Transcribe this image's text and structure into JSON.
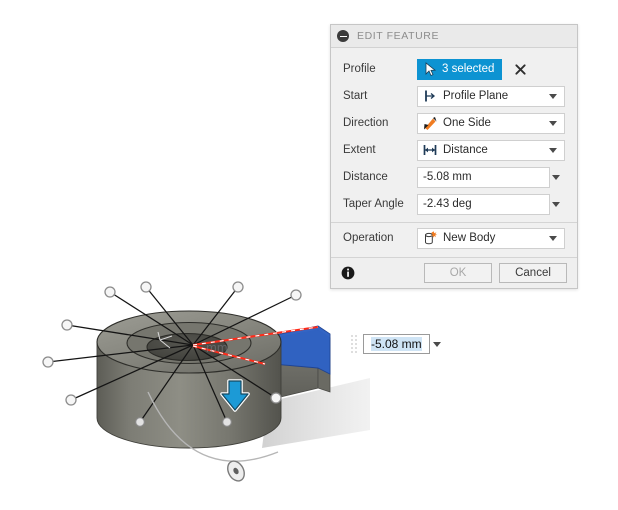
{
  "app": {
    "accent_blue": "#0d93d2",
    "manipulator_blue": "#1c9ad6",
    "highlight_red": "#ff2a18",
    "profile_blue": "#2f62c4",
    "body_grey": "#6f6f68"
  },
  "dialog": {
    "title": "EDIT FEATURE",
    "collapse_icon": "minus-circle-icon",
    "rows": [
      {
        "label": "Profile",
        "control": "selection",
        "value": "3 selected",
        "icon": "cursor-arrow-icon",
        "clear_icon": "close-x-icon"
      },
      {
        "label": "Start",
        "control": "combo",
        "value": "Profile Plane",
        "icon": "profile-plane-icon"
      },
      {
        "label": "Direction",
        "control": "combo",
        "value": "One Side",
        "icon": "one-side-arrow-icon"
      },
      {
        "label": "Extent",
        "control": "combo",
        "value": "Distance",
        "icon": "distance-extent-icon"
      },
      {
        "label": "Distance",
        "control": "value",
        "value": "-5.08 mm"
      },
      {
        "label": "Taper Angle",
        "control": "value",
        "value": "-2.43 deg"
      },
      {
        "label": "Operation",
        "control": "combo",
        "value": "New Body",
        "icon": "new-body-icon"
      }
    ],
    "footer": {
      "info_icon": "info-icon",
      "ok_label": "OK",
      "cancel_label": "Cancel",
      "ok_enabled": false
    }
  },
  "canvas_value_field": {
    "grip_icon": "drag-grip-icon",
    "value": "-5.08 mm",
    "caret_icon": "chevron-down-icon",
    "selected": true
  },
  "viewport": {
    "ghost_label": "mm",
    "manipulator_arrow_icon": "extrude-down-arrow-icon",
    "taper_handle_icon": "taper-angle-handle-icon"
  }
}
